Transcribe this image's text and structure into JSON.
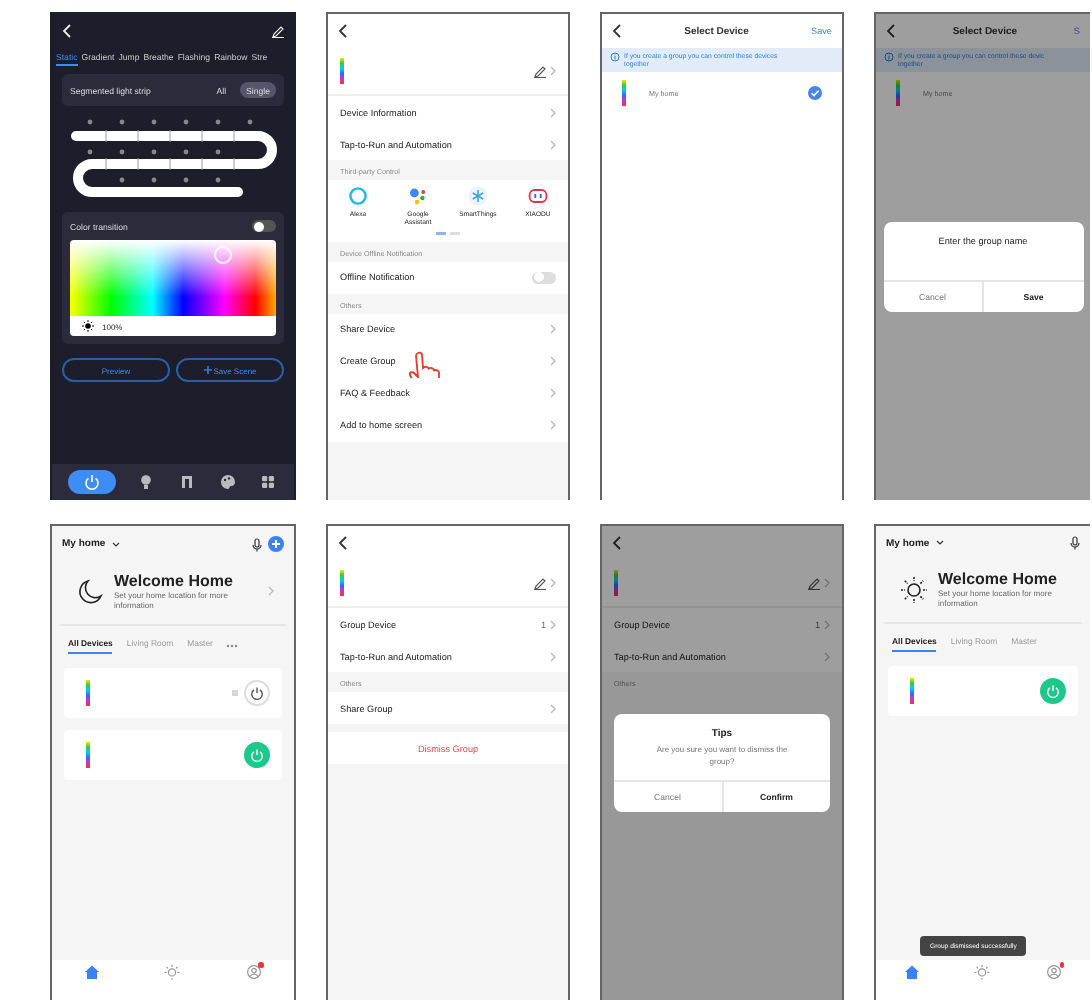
{
  "screens": [
    {
      "kind": "light-control",
      "tabs": [
        {
          "label": "Static",
          "selected": true
        },
        {
          "label": "Gradient",
          "selected": false
        },
        {
          "label": "Jump",
          "selected": false
        },
        {
          "label": "Breathe",
          "selected": false
        },
        {
          "label": "Flashing",
          "selected": false
        },
        {
          "label": "Rainbow",
          "selected": false
        },
        {
          "label": "Stre",
          "selected": false
        }
      ],
      "segment": {
        "label": "Segmented light strip",
        "options": [
          {
            "label": "All",
            "selected": false
          },
          {
            "label": "Single",
            "selected": true
          }
        ]
      },
      "color_transition": {
        "label": "Color transition",
        "on": false
      },
      "brightness": "100%",
      "buttons": [
        {
          "label": "Preview",
          "kind": "plain"
        },
        {
          "label": "Save Scene",
          "kind": "add"
        }
      ],
      "nav": [
        {
          "kind": "power",
          "selected": true
        },
        {
          "kind": "bulb",
          "selected": false
        },
        {
          "kind": "music",
          "selected": false
        },
        {
          "kind": "palette",
          "selected": false
        },
        {
          "kind": "grid",
          "selected": false
        }
      ]
    },
    {
      "kind": "device-settings",
      "rows": [
        {
          "label": "Device Information"
        },
        {
          "label": "Tap-to-Run and Automation"
        }
      ],
      "third_party": {
        "heading": "Third-party Control",
        "services": [
          {
            "name": "Alexa",
            "kind": "ring"
          },
          {
            "name": "Google Assistant",
            "kind": "dots"
          },
          {
            "name": "SmartThings",
            "kind": "snowflake"
          },
          {
            "name": "XIAODU",
            "kind": "robot"
          }
        ]
      },
      "offline": {
        "heading": "Device Offline Notification",
        "label": "Offline Notification",
        "on": false
      },
      "others": {
        "heading": "Others",
        "rows": [
          {
            "label": "Share Device"
          },
          {
            "label": "Create Group",
            "pointed": true
          },
          {
            "label": "FAQ & Feedback"
          },
          {
            "label": "Add to home screen"
          }
        ]
      }
    },
    {
      "kind": "select-device",
      "title": "Select Device",
      "action": "Save",
      "info_lines": [
        "If you create a group you can control these devices",
        "together"
      ],
      "devices": [
        {
          "name": "My home",
          "checked": true
        }
      ]
    },
    {
      "kind": "select-device",
      "title": "Select Device",
      "action": "S",
      "info_lines": [
        "If you create a group you can control these devic",
        "together"
      ],
      "devices": [
        {
          "name": "My home"
        }
      ],
      "dialog": {
        "kind": "input",
        "title": "Enter the group name",
        "buttons": [
          {
            "label": "Cancel",
            "primary": false
          },
          {
            "label": "Save",
            "primary": true
          }
        ]
      }
    },
    {
      "kind": "home",
      "home_name": "My home",
      "add": true,
      "greeting": {
        "kind": "moon",
        "title": "Welcome Home",
        "subtitle": "Set your home location for more information",
        "chevron": true
      },
      "tabs": [
        {
          "label": "All Devices",
          "selected": true
        },
        {
          "label": "Living Room",
          "selected": false
        },
        {
          "label": "Master",
          "selected": false
        }
      ],
      "more": true,
      "devices": [
        {
          "on": false,
          "grouped": true
        },
        {
          "on": true
        }
      ],
      "nav": [
        {
          "kind": "home",
          "selected": true
        },
        {
          "kind": "scene",
          "selected": false
        },
        {
          "kind": "me",
          "selected": false,
          "badge": true
        }
      ]
    },
    {
      "kind": "group-settings",
      "rows": [
        {
          "label": "Group Device",
          "value": "1"
        },
        {
          "label": "Tap-to-Run and Automation"
        }
      ],
      "others": {
        "heading": "Others",
        "rows": [
          {
            "label": "Share Group"
          }
        ]
      },
      "danger": "Dismiss Group"
    },
    {
      "kind": "group-settings",
      "rows": [
        {
          "label": "Group Device",
          "value": "1"
        },
        {
          "label": "Tap-to-Run and Automation"
        }
      ],
      "others": {
        "heading": "Others"
      },
      "dialog": {
        "kind": "confirm",
        "title": "Tips",
        "message": "Are you sure you want to dismiss the group?",
        "buttons": [
          {
            "label": "Cancel",
            "primary": false
          },
          {
            "label": "Confirm",
            "primary": true
          }
        ]
      }
    },
    {
      "kind": "home",
      "home_name": "My home",
      "greeting": {
        "kind": "sun",
        "title": "Welcome Home",
        "subtitle": "Set your home location for more information"
      },
      "tabs": [
        {
          "label": "All Devices",
          "selected": true
        },
        {
          "label": "Living Room",
          "selected": false
        },
        {
          "label": "Master",
          "selected": false
        }
      ],
      "devices": [
        {
          "on": true
        }
      ],
      "nav": [
        {
          "kind": "home",
          "selected": true
        },
        {
          "kind": "scene",
          "selected": false
        },
        {
          "kind": "me",
          "selected": false,
          "badge": true
        }
      ],
      "toast": "Group dismissed successfully"
    }
  ]
}
